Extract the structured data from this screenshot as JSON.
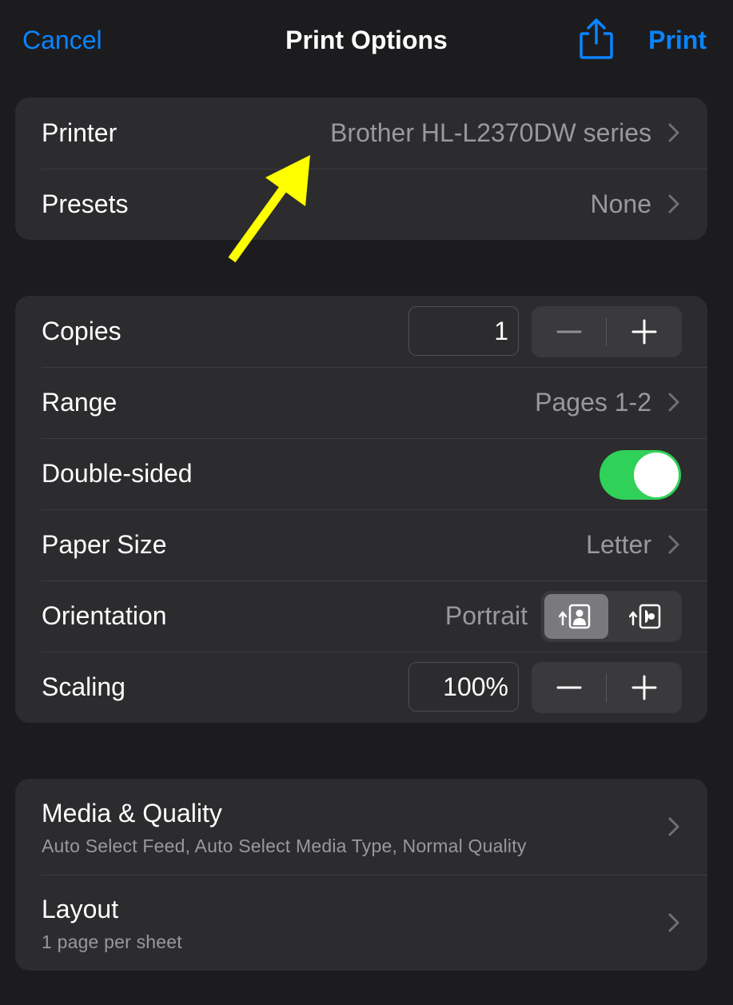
{
  "nav": {
    "cancel_label": "Cancel",
    "title": "Print Options",
    "print_label": "Print",
    "share_icon": "share-icon"
  },
  "printer_group": {
    "printer_label": "Printer",
    "printer_value": "Brother HL-L2370DW series",
    "presets_label": "Presets",
    "presets_value": "None"
  },
  "options_group": {
    "copies_label": "Copies",
    "copies_value": "1",
    "range_label": "Range",
    "range_value": "Pages 1-2",
    "double_sided_label": "Double-sided",
    "double_sided_on": true,
    "paper_size_label": "Paper Size",
    "paper_size_value": "Letter",
    "orientation_label": "Orientation",
    "orientation_value": "Portrait",
    "scaling_label": "Scaling",
    "scaling_value": "100%"
  },
  "more_group": {
    "media_label": "Media & Quality",
    "media_sub": "Auto Select Feed, Auto Select Media Type, Normal Quality",
    "layout_label": "Layout",
    "layout_sub": "1 page per sheet"
  },
  "colors": {
    "accent": "#0a84ff",
    "toggle_on": "#30d158",
    "annotation_arrow": "#ffff00",
    "background": "#1c1c1e",
    "cell": "#2c2c2e"
  }
}
